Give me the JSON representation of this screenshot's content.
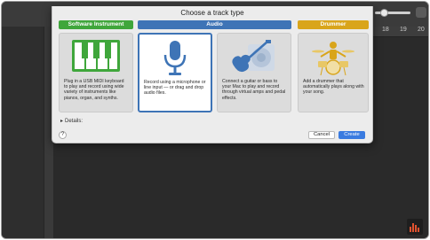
{
  "sheet": {
    "title": "Choose a track type"
  },
  "ruler": {
    "numbers": [
      "18",
      "19",
      "20"
    ]
  },
  "categories": {
    "software": "Software Instrument",
    "audio": "Audio",
    "drummer": "Drummer"
  },
  "cards": [
    {
      "name": "software-instrument-card",
      "icon": "piano-keyboard-icon",
      "description": "Plug in a USB MIDI keyboard to play and record using wide variety of instruments like pianos, organ, and synths."
    },
    {
      "name": "microphone-card",
      "icon": "microphone-icon",
      "description": "Record using a microphone or line input — or drag and drop audio files."
    },
    {
      "name": "guitar-bass-card",
      "icon": "guitar-amp-icon",
      "description": "Connect a guitar or bass to your Mac to play and record through virtual amps and pedal effects."
    },
    {
      "name": "drummer-card",
      "icon": "drummer-icon",
      "description": "Add a drummer that automatically plays along with your song."
    }
  ],
  "details_label": "Details:",
  "buttons": {
    "help": "?",
    "cancel": "Cancel",
    "create": "Create"
  },
  "colors": {
    "software": "#3fa63b",
    "audio": "#3e74b6",
    "drummer": "#d9a51b",
    "create": "#3a7be0"
  }
}
